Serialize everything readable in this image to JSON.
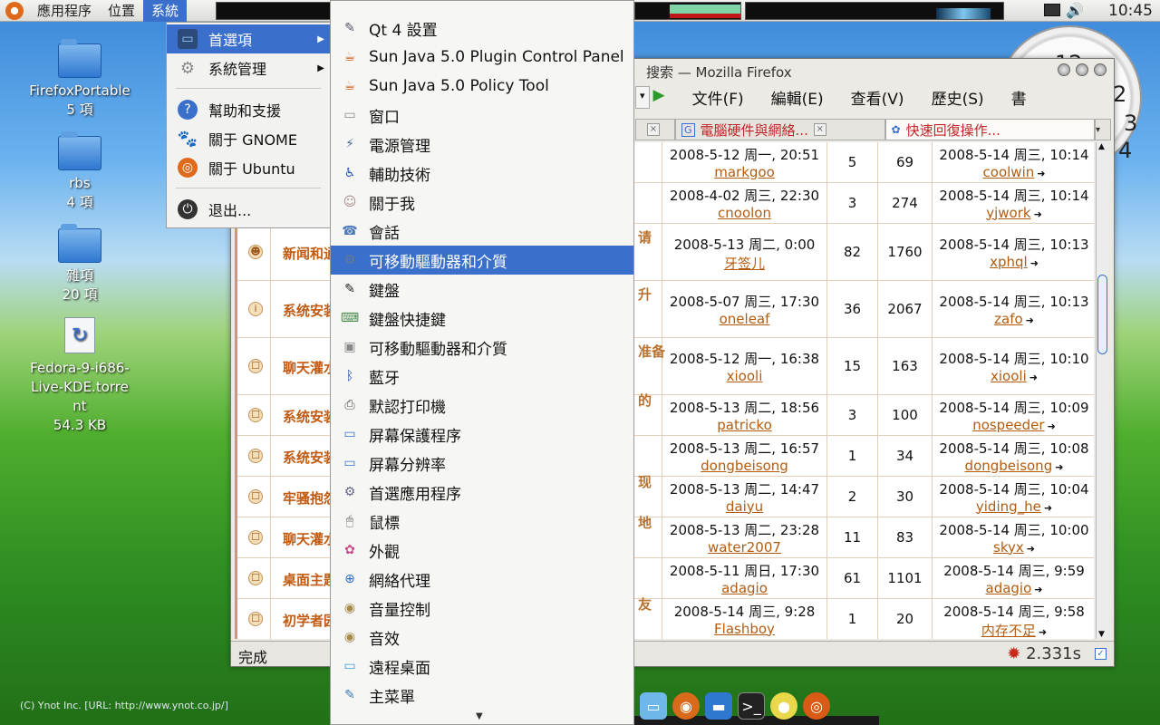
{
  "top_panel": {
    "menus": [
      "應用程序",
      "位置",
      "系統"
    ],
    "clock": "10:45"
  },
  "desktop": {
    "icons": [
      {
        "name": "FirefoxPortable",
        "detail": "5 項"
      },
      {
        "name": "rbs",
        "detail": "4 項"
      },
      {
        "name": "雜項",
        "detail": "20 項"
      },
      {
        "name": "Fedora-9-i686-Live-KDE.torrent",
        "detail": "54.3 KB"
      }
    ],
    "copyright": "(C) Ynot Inc. [URL: http://www.ynot.co.jp/]"
  },
  "clock_widget": {
    "numbers": [
      "12",
      "2",
      "3",
      "4"
    ]
  },
  "system_menu": {
    "items": [
      {
        "label": "首選項",
        "icon": "preferences-icon",
        "submenu": true
      },
      {
        "label": "系統管理",
        "icon": "gear-icon",
        "submenu": true
      },
      {
        "label": "幫助和支援",
        "icon": "help-icon",
        "submenu": false
      },
      {
        "label": "關于 GNOME",
        "icon": "gnome-icon",
        "submenu": false
      },
      {
        "label": "關于 Ubuntu",
        "icon": "ubuntu-icon",
        "submenu": false
      },
      {
        "label": "退出...",
        "icon": "power-icon",
        "submenu": false
      }
    ]
  },
  "preferences_menu": {
    "items": [
      "Qt 4 設置",
      "Sun Java 5.0 Plugin Control Panel",
      "Sun Java 5.0 Policy Tool",
      "窗口",
      "電源管理",
      "輔助技術",
      "關于我",
      "會話",
      "可移動驅動器和介質",
      "鍵盤",
      "鍵盤快捷鍵",
      "可移動驅動器和介質",
      "藍牙",
      "默認打印機",
      "屏幕保護程序",
      "屏幕分辨率",
      "首選應用程序",
      "鼠標",
      "外觀",
      "網絡代理",
      "音量控制",
      "音效",
      "遠程桌面",
      "主菜單"
    ],
    "highlighted_index": 8
  },
  "firefox": {
    "title": "搜索 — Mozilla Firefox",
    "menubar": [
      "文件(F)",
      "編輯(E)",
      "查看(V)",
      "歷史(S)",
      "書"
    ],
    "tabs": [
      {
        "label": "",
        "active": false
      },
      {
        "label": "電腦硬件與網絡...",
        "active": false
      },
      {
        "label": "快速回復操作...",
        "active": true
      }
    ],
    "status": "完成",
    "load_time": "2.331s",
    "rows": [
      {
        "title": "",
        "side": "",
        "post_time": "2008-5-12 周一, 20:51",
        "author": "markgoo",
        "replies": "5",
        "views": "69",
        "last_time": "2008-5-14 周三, 10:14",
        "last_user": "coolwin",
        "icon": ""
      },
      {
        "title": "",
        "side": "",
        "post_time": "2008-4-02 周三, 22:30",
        "author": "cnoolon",
        "replies": "3",
        "views": "274",
        "last_time": "2008-5-14 周三, 10:14",
        "last_user": "yjwork",
        "icon": ""
      },
      {
        "title": "新闻和通",
        "side": "请",
        "post_time": "2008-5-13 周二, 0:00",
        "author": "牙签儿",
        "replies": "82",
        "views": "1760",
        "last_time": "2008-5-14 周三, 10:13",
        "last_user": "xphql",
        "icon": "globe-icon"
      },
      {
        "title": "系统安装",
        "side": "升",
        "post_time": "2008-5-07 周三, 17:30",
        "author": "oneleaf",
        "replies": "36",
        "views": "2067",
        "last_time": "2008-5-14 周三, 10:13",
        "last_user": "zafo",
        "icon": "info-icon"
      },
      {
        "title": "聊天灌水",
        "side": "准备",
        "post_time": "2008-5-12 周一, 16:38",
        "author": "xiooli",
        "replies": "15",
        "views": "163",
        "last_time": "2008-5-14 周三, 10:10",
        "last_user": "xiooli",
        "icon": "topic-icon"
      },
      {
        "title": "系统安装",
        "side": "的",
        "post_time": "2008-5-13 周二, 18:56",
        "author": "patricko",
        "replies": "3",
        "views": "100",
        "last_time": "2008-5-14 周三, 10:09",
        "last_user": "nospeeder",
        "icon": "topic-icon"
      },
      {
        "title": "系统安装",
        "side": "",
        "post_time": "2008-5-13 周二, 16:57",
        "author": "dongbeisong",
        "replies": "1",
        "views": "34",
        "last_time": "2008-5-14 周三, 10:08",
        "last_user": "dongbeisong",
        "icon": "topic-icon"
      },
      {
        "title": "牢骚抱怨",
        "side": "现",
        "post_time": "2008-5-13 周二, 14:47",
        "author": "daiyu",
        "replies": "2",
        "views": "30",
        "last_time": "2008-5-14 周三, 10:04",
        "last_user": "yiding_he",
        "icon": "topic-icon"
      },
      {
        "title": "聊天灌水",
        "side": "地",
        "post_time": "2008-5-13 周二, 23:28",
        "author": "water2007",
        "replies": "11",
        "views": "83",
        "last_time": "2008-5-14 周三, 10:00",
        "last_user": "skyx",
        "icon": "topic-icon"
      },
      {
        "title": "桌面主题",
        "side": "",
        "post_time": "2008-5-11 周日, 17:30",
        "author": "adagio",
        "replies": "61",
        "views": "1101",
        "last_time": "2008-5-14 周三, 9:59",
        "last_user": "adagio",
        "icon": "topic-icon"
      },
      {
        "title": "初学者园",
        "side": "友",
        "post_time": "2008-5-14 周三, 9:28",
        "author": "Flashboy",
        "replies": "1",
        "views": "20",
        "last_time": "2008-5-14 周三, 9:58",
        "last_user": "内存不足",
        "icon": "topic-icon"
      }
    ]
  }
}
